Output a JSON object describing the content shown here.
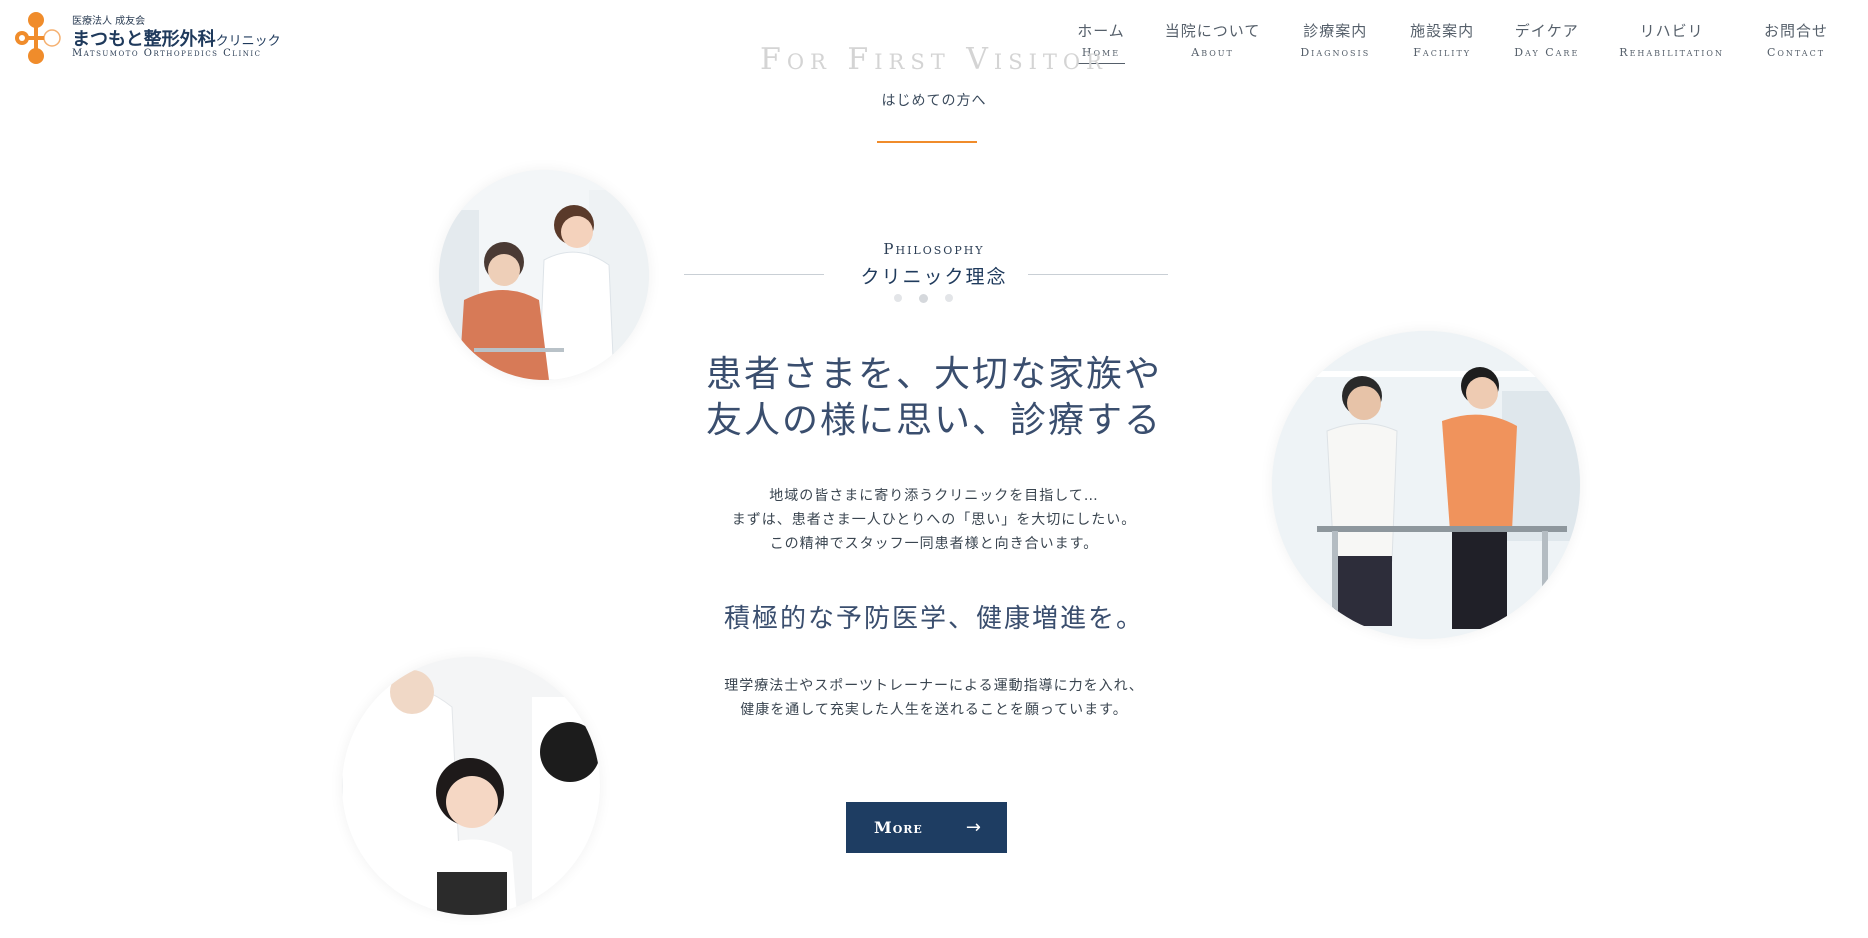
{
  "logo": {
    "corp": "医療法人 成友会",
    "name": "まつもと整形外科",
    "name_suffix": "クリニック",
    "en": "Matsumoto Orthopedics Clinic"
  },
  "nav": [
    {
      "ja": "ホーム",
      "en": "Home"
    },
    {
      "ja": "当院について",
      "en": "About"
    },
    {
      "ja": "診療案内",
      "en": "Diagnosis"
    },
    {
      "ja": "施設案内",
      "en": "Facility"
    },
    {
      "ja": "デイケア",
      "en": "Day Care"
    },
    {
      "ja": "リハビリ",
      "en": "Rehabilitation"
    },
    {
      "ja": "お問合せ",
      "en": "Contact"
    }
  ],
  "visitor": {
    "en": "For First Visitor",
    "ja": "はじめての方へ"
  },
  "philosophy": {
    "en": "Philosophy",
    "ja": "クリニック理念",
    "headline_1": "患者さまを、大切な家族や",
    "headline_2": "友人の様に思い、診療する",
    "body1_1": "地域の皆さまに寄り添うクリニックを目指して…",
    "body1_2": "まずは、患者さま一人ひとりへの「思い」を大切にしたい。",
    "body1_3": "この精神でスタッフ一同患者様と向き合います。",
    "sub_head": "積極的な予防医学、健康増進を。",
    "body2_1": "理学療法士やスポーツトレーナーによる運動指導に力を入れ、",
    "body2_2": "健康を通して充実した人生を送れることを願っています。",
    "more": "More"
  },
  "colors": {
    "accent": "#f08c2b",
    "navy": "#1e3d62"
  }
}
